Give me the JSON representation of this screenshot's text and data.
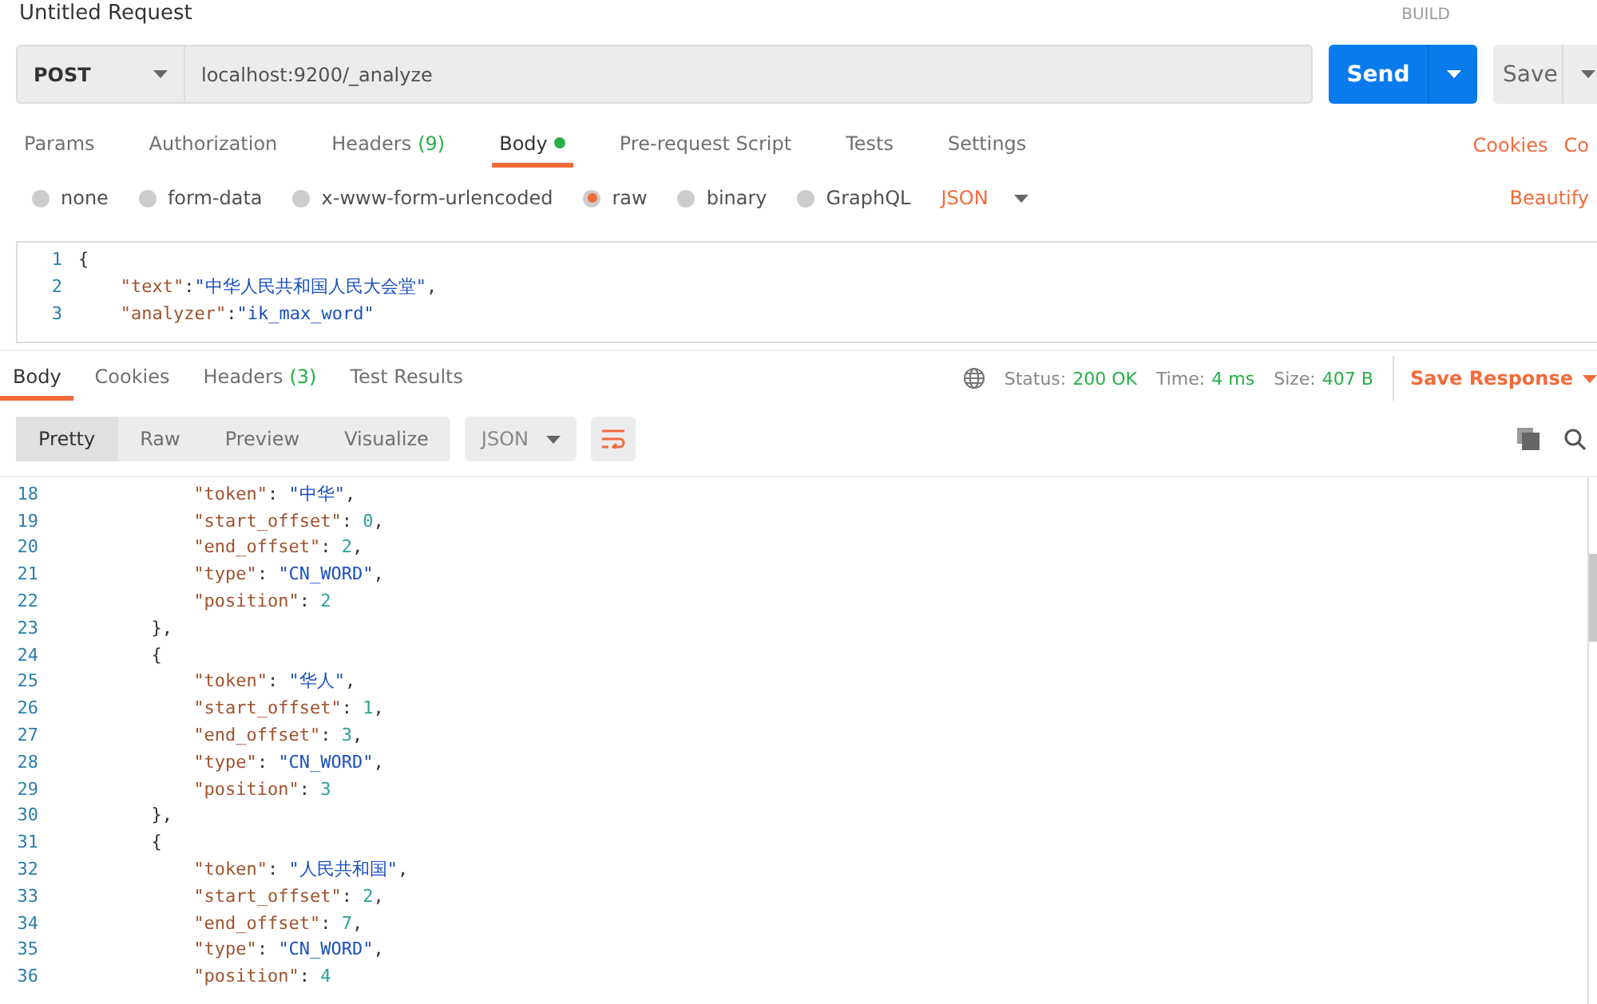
{
  "header": {
    "title": "Untitled Request",
    "build": "BUILD"
  },
  "request": {
    "method": "POST",
    "url": "localhost:9200/_analyze",
    "send": "Send",
    "save": "Save"
  },
  "request_tabs": [
    {
      "label": "Params",
      "selected": false
    },
    {
      "label": "Authorization",
      "selected": false
    },
    {
      "label": "Headers",
      "count": "(9)",
      "selected": false
    },
    {
      "label": "Body",
      "dot": true,
      "selected": true
    },
    {
      "label": "Pre-request Script",
      "selected": false
    },
    {
      "label": "Tests",
      "selected": false
    },
    {
      "label": "Settings",
      "selected": false
    }
  ],
  "request_links": [
    "Cookies",
    "Co"
  ],
  "body_types": [
    {
      "label": "none",
      "selected": false
    },
    {
      "label": "form-data",
      "selected": false
    },
    {
      "label": "x-www-form-urlencoded",
      "selected": false
    },
    {
      "label": "raw",
      "selected": true
    },
    {
      "label": "binary",
      "selected": false
    },
    {
      "label": "GraphQL",
      "selected": false
    }
  ],
  "body_format": "JSON",
  "beautify": "Beautify",
  "request_body": [
    {
      "number": "1",
      "kind": "brace",
      "segments": [
        {
          "kind": "punct",
          "text": "{"
        }
      ]
    },
    {
      "number": "2",
      "kind": "member",
      "segments": [
        {
          "kind": "key",
          "text": "\"text\""
        },
        {
          "kind": "punct",
          "text": ":"
        },
        {
          "kind": "string",
          "text": "\"中华人民共和国人民大会堂\""
        },
        {
          "kind": "punct",
          "text": ","
        }
      ]
    },
    {
      "number": "3",
      "kind": "member",
      "segments": [
        {
          "kind": "key",
          "text": "\"analyzer\""
        },
        {
          "kind": "punct",
          "text": ":"
        },
        {
          "kind": "string",
          "text": "\"ik_max_word\""
        }
      ]
    }
  ],
  "response_tabs": [
    {
      "label": "Body",
      "selected": true
    },
    {
      "label": "Cookies",
      "selected": false
    },
    {
      "label": "Headers",
      "count": "(3)",
      "selected": false
    },
    {
      "label": "Test Results",
      "selected": false
    }
  ],
  "status": [
    {
      "label": "Status:",
      "value": "200 OK"
    },
    {
      "label": "Time:",
      "value": "4 ms"
    },
    {
      "label": "Size:",
      "value": "407 B"
    }
  ],
  "save_response": "Save Response",
  "view_modes": [
    {
      "label": "Pretty",
      "selected": true
    },
    {
      "label": "Raw",
      "selected": false
    },
    {
      "label": "Preview",
      "selected": false
    },
    {
      "label": "Visualize",
      "selected": false
    }
  ],
  "response_format": "JSON",
  "response_body": [
    {
      "number": "18",
      "kind": "member",
      "segments": [
        {
          "kind": "key",
          "text": "\"token\""
        },
        {
          "kind": "punct",
          "text": ": "
        },
        {
          "kind": "string",
          "text": "\"中华\""
        },
        {
          "kind": "punct",
          "text": ","
        }
      ]
    },
    {
      "number": "19",
      "kind": "member",
      "segments": [
        {
          "kind": "key",
          "text": "\"start_offset\""
        },
        {
          "kind": "punct",
          "text": ": "
        },
        {
          "kind": "number",
          "text": "0"
        },
        {
          "kind": "punct",
          "text": ","
        }
      ]
    },
    {
      "number": "20",
      "kind": "member",
      "segments": [
        {
          "kind": "key",
          "text": "\"end_offset\""
        },
        {
          "kind": "punct",
          "text": ": "
        },
        {
          "kind": "number",
          "text": "2"
        },
        {
          "kind": "punct",
          "text": ","
        }
      ]
    },
    {
      "number": "21",
      "kind": "member",
      "segments": [
        {
          "kind": "key",
          "text": "\"type\""
        },
        {
          "kind": "punct",
          "text": ": "
        },
        {
          "kind": "string",
          "text": "\"CN_WORD\""
        },
        {
          "kind": "punct",
          "text": ","
        }
      ]
    },
    {
      "number": "22",
      "kind": "member",
      "segments": [
        {
          "kind": "key",
          "text": "\"position\""
        },
        {
          "kind": "punct",
          "text": ": "
        },
        {
          "kind": "number",
          "text": "2"
        }
      ]
    },
    {
      "number": "23",
      "kind": "brace",
      "segments": [
        {
          "kind": "punct",
          "text": "},"
        }
      ]
    },
    {
      "number": "24",
      "kind": "brace",
      "segments": [
        {
          "kind": "punct",
          "text": "{"
        }
      ]
    },
    {
      "number": "25",
      "kind": "member",
      "segments": [
        {
          "kind": "key",
          "text": "\"token\""
        },
        {
          "kind": "punct",
          "text": ": "
        },
        {
          "kind": "string",
          "text": "\"华人\""
        },
        {
          "kind": "punct",
          "text": ","
        }
      ]
    },
    {
      "number": "26",
      "kind": "member",
      "segments": [
        {
          "kind": "key",
          "text": "\"start_offset\""
        },
        {
          "kind": "punct",
          "text": ": "
        },
        {
          "kind": "number",
          "text": "1"
        },
        {
          "kind": "punct",
          "text": ","
        }
      ]
    },
    {
      "number": "27",
      "kind": "member",
      "segments": [
        {
          "kind": "key",
          "text": "\"end_offset\""
        },
        {
          "kind": "punct",
          "text": ": "
        },
        {
          "kind": "number",
          "text": "3"
        },
        {
          "kind": "punct",
          "text": ","
        }
      ]
    },
    {
      "number": "28",
      "kind": "member",
      "segments": [
        {
          "kind": "key",
          "text": "\"type\""
        },
        {
          "kind": "punct",
          "text": ": "
        },
        {
          "kind": "string",
          "text": "\"CN_WORD\""
        },
        {
          "kind": "punct",
          "text": ","
        }
      ]
    },
    {
      "number": "29",
      "kind": "member",
      "segments": [
        {
          "kind": "key",
          "text": "\"position\""
        },
        {
          "kind": "punct",
          "text": ": "
        },
        {
          "kind": "number",
          "text": "3"
        }
      ]
    },
    {
      "number": "30",
      "kind": "brace",
      "segments": [
        {
          "kind": "punct",
          "text": "},"
        }
      ]
    },
    {
      "number": "31",
      "kind": "brace",
      "segments": [
        {
          "kind": "punct",
          "text": "{"
        }
      ]
    },
    {
      "number": "32",
      "kind": "member",
      "segments": [
        {
          "kind": "key",
          "text": "\"token\""
        },
        {
          "kind": "punct",
          "text": ": "
        },
        {
          "kind": "string",
          "text": "\"人民共和国\""
        },
        {
          "kind": "punct",
          "text": ","
        }
      ]
    },
    {
      "number": "33",
      "kind": "member",
      "segments": [
        {
          "kind": "key",
          "text": "\"start_offset\""
        },
        {
          "kind": "punct",
          "text": ": "
        },
        {
          "kind": "number",
          "text": "2"
        },
        {
          "kind": "punct",
          "text": ","
        }
      ]
    },
    {
      "number": "34",
      "kind": "member",
      "segments": [
        {
          "kind": "key",
          "text": "\"end_offset\""
        },
        {
          "kind": "punct",
          "text": ": "
        },
        {
          "kind": "number",
          "text": "7"
        },
        {
          "kind": "punct",
          "text": ","
        }
      ]
    },
    {
      "number": "35",
      "kind": "member",
      "segments": [
        {
          "kind": "key",
          "text": "\"type\""
        },
        {
          "kind": "punct",
          "text": ": "
        },
        {
          "kind": "string",
          "text": "\"CN_WORD\""
        },
        {
          "kind": "punct",
          "text": ","
        }
      ]
    },
    {
      "number": "36",
      "kind": "member",
      "segments": [
        {
          "kind": "key",
          "text": "\"position\""
        },
        {
          "kind": "punct",
          "text": ": "
        },
        {
          "kind": "number",
          "text": "4"
        }
      ]
    }
  ]
}
